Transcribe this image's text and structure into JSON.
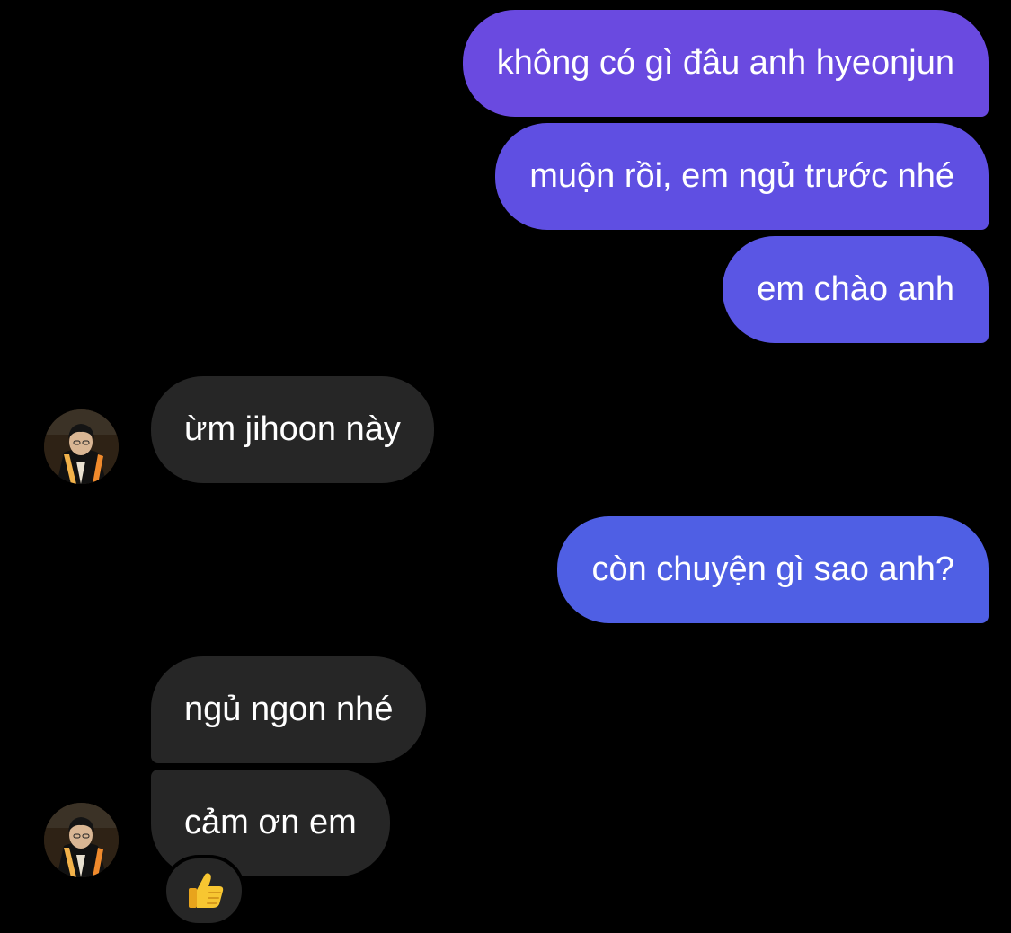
{
  "messages": [
    {
      "id": "m1",
      "direction": "outgoing",
      "text": "không có gì đâu anh hyeonjun",
      "bg": "#6a4ae0"
    },
    {
      "id": "m2",
      "direction": "outgoing",
      "text": "muộn rồi, em ngủ trước nhé",
      "bg": "#5f4fe2"
    },
    {
      "id": "m3",
      "direction": "outgoing",
      "text": "em chào anh",
      "bg": "#5a56e4"
    },
    {
      "id": "m4",
      "direction": "incoming",
      "text": "ừm jihoon này",
      "bg": "#262626"
    },
    {
      "id": "m5",
      "direction": "outgoing",
      "text": "còn chuyện gì sao anh?",
      "bg": "#4f5fe4"
    },
    {
      "id": "m6",
      "direction": "incoming",
      "text": "ngủ ngon nhé",
      "bg": "#262626"
    },
    {
      "id": "m7",
      "direction": "incoming",
      "text": "cảm ơn em",
      "bg": "#262626"
    }
  ],
  "reaction": {
    "icon": "thumbs-up-icon",
    "target_message": "m7"
  },
  "avatar": {
    "icon": "contact-avatar-photo"
  },
  "colors": {
    "background": "#000000",
    "incoming_bubble": "#262626",
    "text": "#ffffff"
  }
}
